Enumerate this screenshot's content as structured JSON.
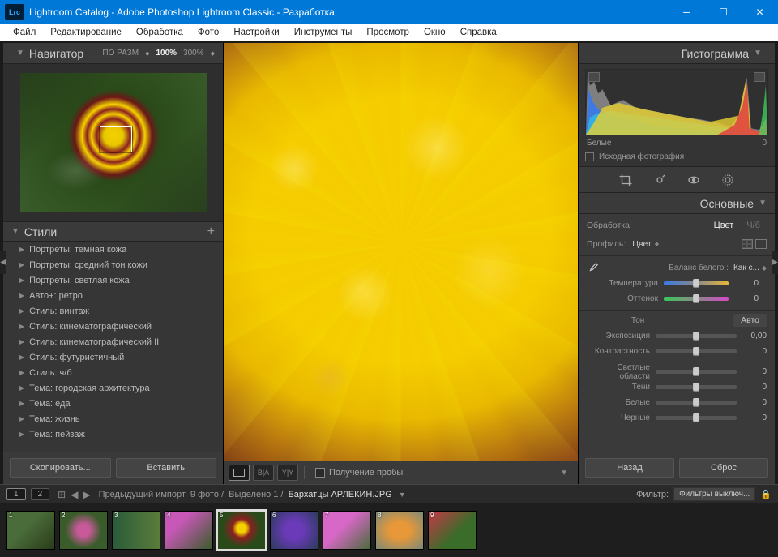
{
  "window": {
    "logo": "Lrc",
    "title": "Lightroom Catalog - Adobe Photoshop Lightroom Classic - Разработка"
  },
  "menubar": [
    "Файл",
    "Редактирование",
    "Обработка",
    "Фото",
    "Настройки",
    "Инструменты",
    "Просмотр",
    "Окно",
    "Справка"
  ],
  "navigator": {
    "title": "Навигатор",
    "zoom_mode_label": "ПО РАЗМ",
    "zoom_100": "100%",
    "zoom_300": "300%"
  },
  "styles": {
    "title": "Стили",
    "items": [
      "Портреты: темная кожа",
      "Портреты: средний тон кожи",
      "Портреты: светлая кожа",
      "Авто+: ретро",
      "Стиль: винтаж",
      "Стиль: кинематографический",
      "Стиль: кинематографический II",
      "Стиль: футуристичный",
      "Стиль: ч/б",
      "Тема: городская архитектура",
      "Тема: еда",
      "Тема: жизнь",
      "Тема: пейзаж"
    ]
  },
  "left_buttons": {
    "copy": "Скопировать...",
    "paste": "Вставить"
  },
  "center_toolbar": {
    "soft_proof_label": "Получение пробы"
  },
  "histogram": {
    "title": "Гистограмма",
    "readout_label": "Белые",
    "readout_value": "0",
    "original_label": "Исходная фотография"
  },
  "basic": {
    "title": "Основные",
    "treatment_label": "Обработка:",
    "treatment_color": "Цвет",
    "treatment_bw": "Ч/б",
    "profile_label": "Профиль:",
    "profile_value": "Цвет",
    "wb_label": "Баланс белого :",
    "wb_preset": "Как с...",
    "sliders": {
      "temp": {
        "label": "Температура",
        "value": "0"
      },
      "tint": {
        "label": "Оттенок",
        "value": "0"
      },
      "tone_label": "Тон",
      "auto_label": "Авто",
      "exposure": {
        "label": "Экспозиция",
        "value": "0,00"
      },
      "contrast": {
        "label": "Контрастность",
        "value": "0"
      },
      "highlights": {
        "label": "Светлые области",
        "value": "0"
      },
      "shadows": {
        "label": "Тени",
        "value": "0"
      },
      "whites": {
        "label": "Белые",
        "value": "0"
      },
      "blacks": {
        "label": "Черные",
        "value": "0"
      }
    }
  },
  "right_buttons": {
    "back": "Назад",
    "reset": "Сброс"
  },
  "filmstrip_bar": {
    "badge1": "1",
    "badge2": "2",
    "source": "Предыдущий импорт",
    "count": "9 фото /",
    "selected": "Выделено 1 /",
    "filename": "Бархатцы АРЛЕКИН.JPG",
    "filter_label": "Фильтр:",
    "filter_value": "Фильтры выключ..."
  },
  "thumbs": [
    "1",
    "2",
    "3",
    "4",
    "5",
    "6",
    "7",
    "8",
    "9"
  ]
}
